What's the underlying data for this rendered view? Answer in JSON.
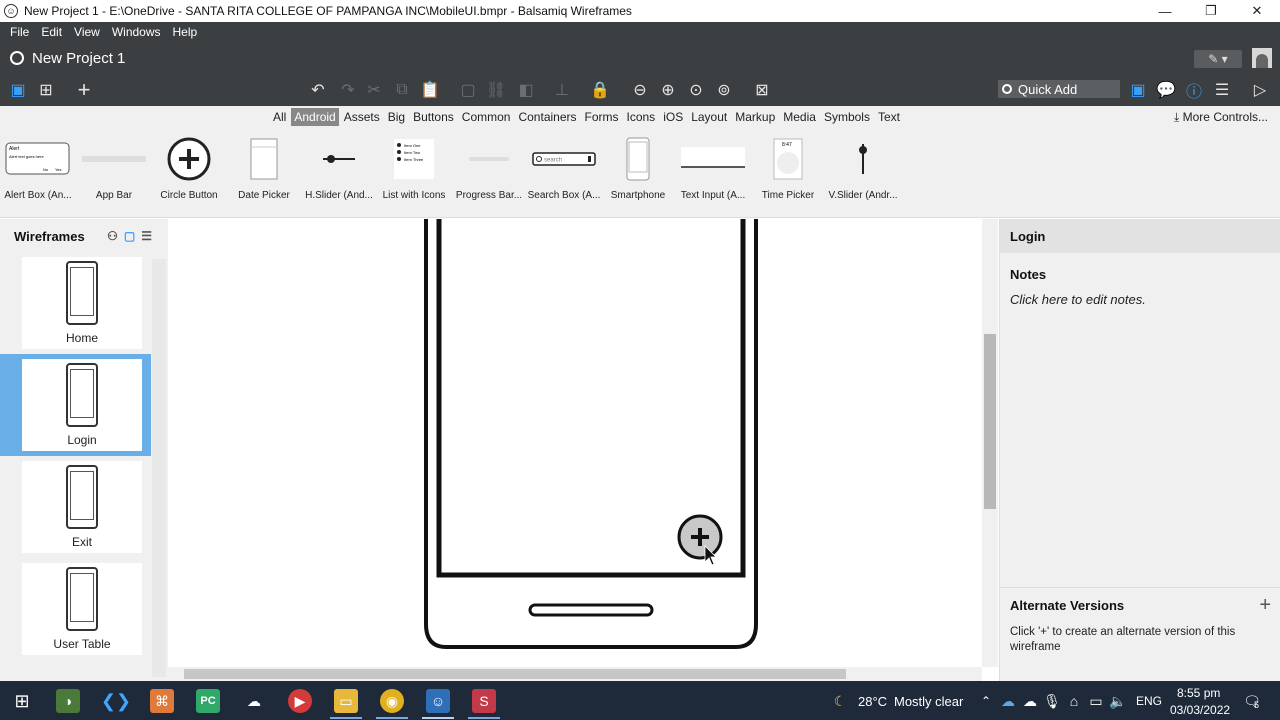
{
  "window": {
    "title": "New Project 1 - E:\\OneDrive - SANTA RITA COLLEGE OF PAMPANGA INC\\MobileUI.bmpr - Balsamiq Wireframes",
    "minimize": "—",
    "maximize": "❐",
    "close": "✕"
  },
  "menu": [
    "File",
    "Edit",
    "View",
    "Windows",
    "Help"
  ],
  "project": {
    "title": "New Project 1",
    "edit_mode": "✎ ▾"
  },
  "toolbar": {
    "quick_add_placeholder": "Quick Add"
  },
  "filters": {
    "items": [
      "All",
      "Android",
      "Assets",
      "Big",
      "Buttons",
      "Common",
      "Containers",
      "Forms",
      "Icons",
      "iOS",
      "Layout",
      "Markup",
      "Media",
      "Symbols",
      "Text"
    ],
    "active": "Android",
    "more_controls": "More Controls..."
  },
  "library": [
    {
      "label": "Alert Box (An...",
      "icon": "alert-box"
    },
    {
      "label": "App Bar",
      "icon": "app-bar"
    },
    {
      "label": "Circle Button",
      "icon": "circle-button"
    },
    {
      "label": "Date Picker",
      "icon": "date-picker"
    },
    {
      "label": "H.Slider (And...",
      "icon": "h-slider"
    },
    {
      "label": "List with Icons",
      "icon": "list-with-icons"
    },
    {
      "label": "Progress Bar...",
      "icon": "progress-bar"
    },
    {
      "label": "Search Box (A...",
      "icon": "search-box"
    },
    {
      "label": "Smartphone",
      "icon": "smartphone"
    },
    {
      "label": "Text Input (A...",
      "icon": "text-input"
    },
    {
      "label": "Time Picker",
      "icon": "time-picker"
    },
    {
      "label": "V.Slider (Andr...",
      "icon": "v-slider"
    }
  ],
  "library_thumb_text": {
    "alert_title": "Alert",
    "alert_body": "Alert text goes here",
    "alert_no": "No",
    "alert_yes": "Yes",
    "search": "search",
    "list": [
      "Item One",
      "Item Two",
      "Item Three"
    ],
    "time": "8:47"
  },
  "wireframes": {
    "title": "Wireframes",
    "items": [
      "Home",
      "Login",
      "Exit",
      "User Table"
    ],
    "selected": "Login"
  },
  "inspector": {
    "title": "Login",
    "notes_heading": "Notes",
    "notes_placeholder": "Click here to edit notes.",
    "alt_heading": "Alternate Versions",
    "alt_text": "Click '+' to create an alternate version of this wireframe"
  },
  "taskbar": {
    "weather_temp": "28°C",
    "weather_desc": "Mostly clear",
    "language": "ENG",
    "time": "8:55 pm",
    "date": "03/03/2022",
    "notifications": "5"
  },
  "colors": {
    "chrome_dark": "#3c3f41",
    "selection_blue": "#6aaee8",
    "taskbar": "#1e2a3a",
    "accent_blue": "#39a0ff"
  }
}
